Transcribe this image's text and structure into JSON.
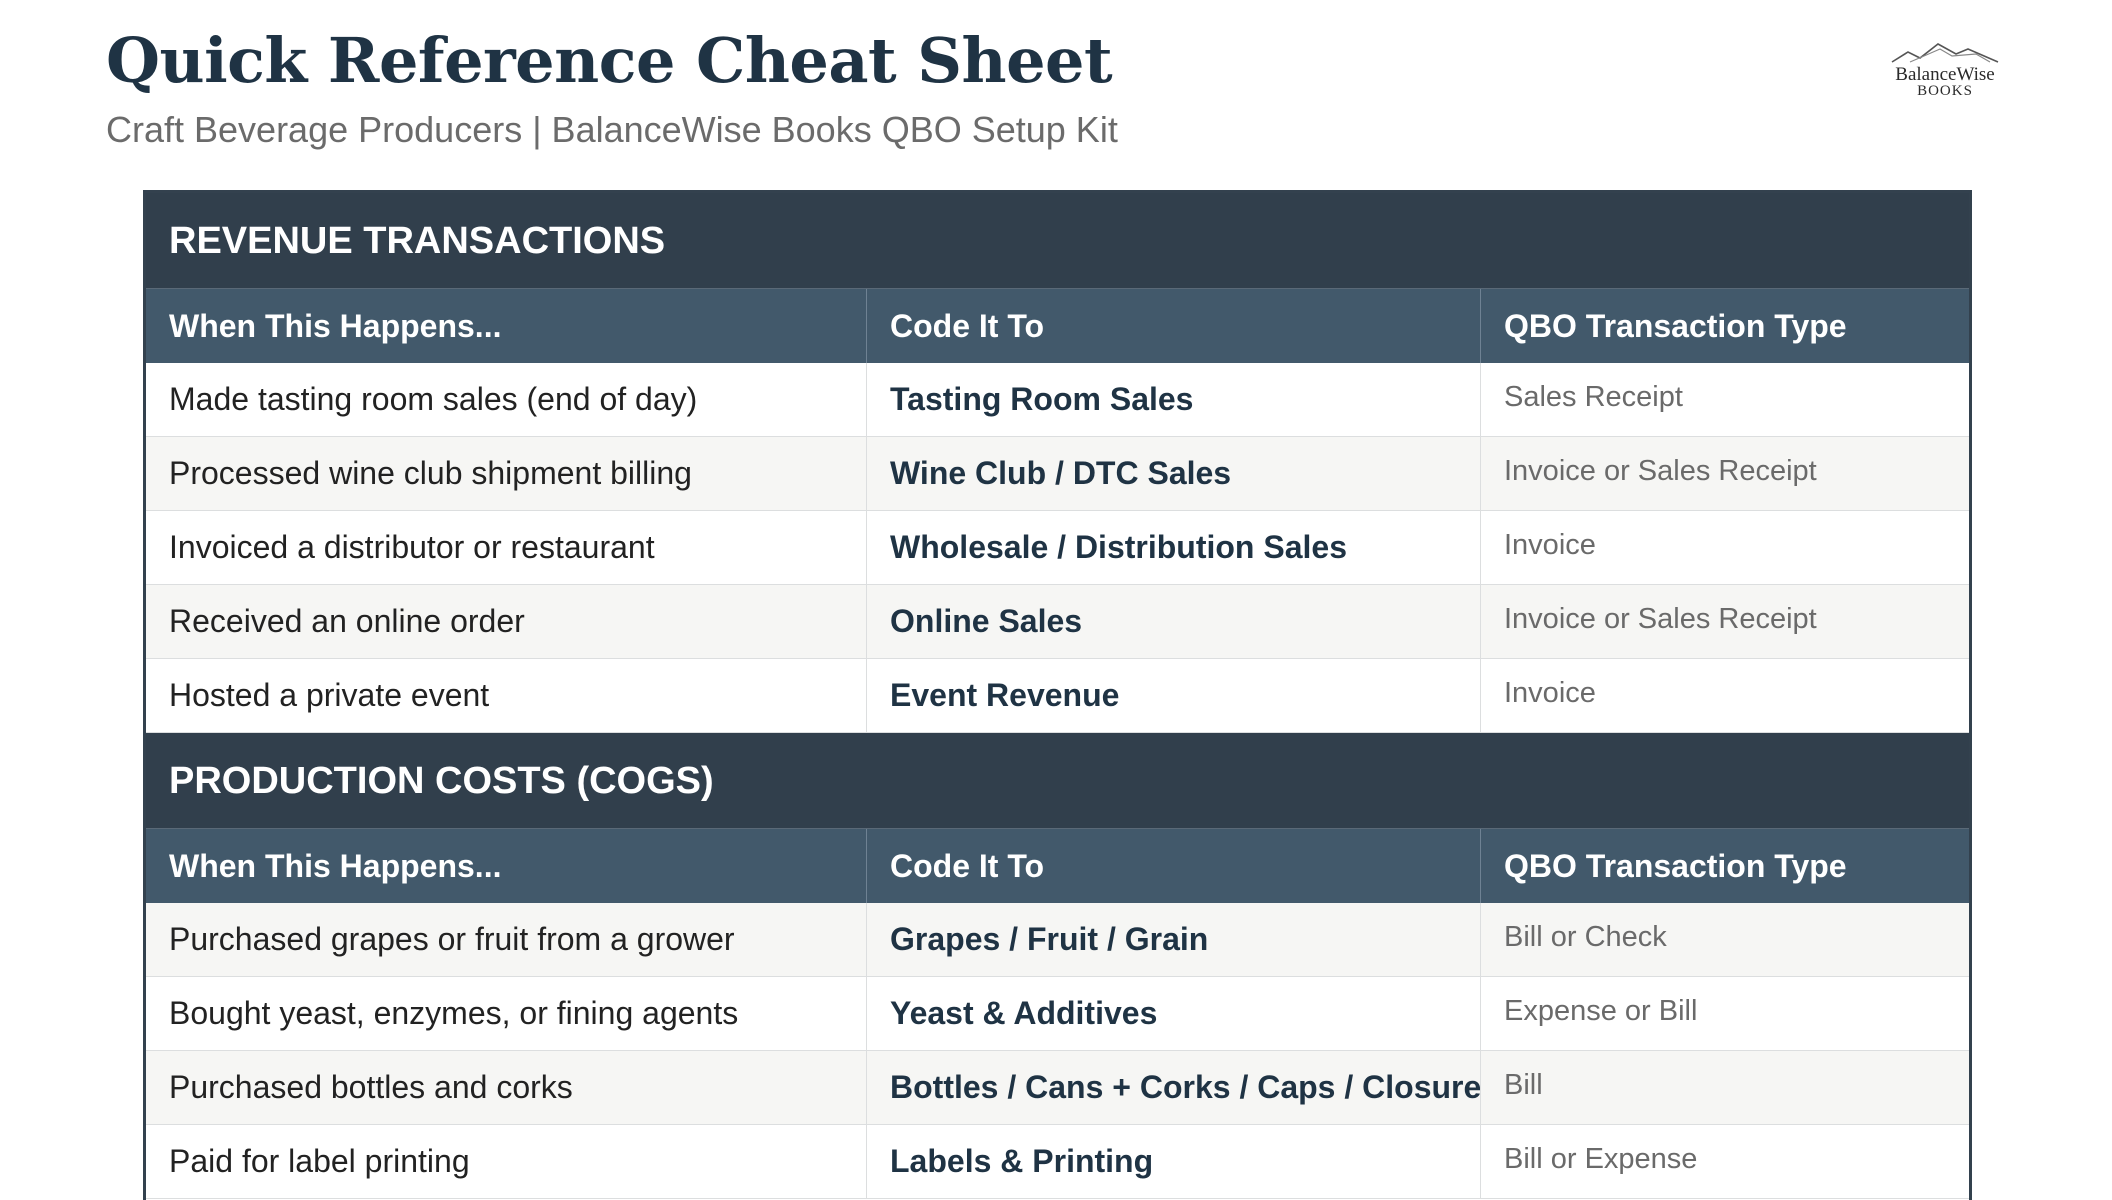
{
  "header": {
    "title": "Quick Reference Cheat Sheet",
    "subtitle": "Craft Beverage Producers | BalanceWise Books QBO Setup Kit"
  },
  "logo": {
    "line1": "BalanceWise",
    "line2": "BOOKS",
    "icon": "mountain-logo-icon",
    "color": "#555555"
  },
  "colors": {
    "section_header": "#313f4c",
    "column_header": "#42596b",
    "title": "#1f3344",
    "alt_row": "#f6f6f4"
  },
  "columns": [
    "When This Happens...",
    "Code It To",
    "QBO Transaction Type"
  ],
  "sections": [
    {
      "title": "REVENUE TRANSACTIONS",
      "rows": [
        [
          "Made tasting room sales (end of day)",
          "Tasting Room Sales",
          "Sales Receipt"
        ],
        [
          "Processed wine club shipment billing",
          "Wine Club / DTC Sales",
          "Invoice or Sales Receipt"
        ],
        [
          "Invoiced a distributor or restaurant",
          "Wholesale / Distribution Sales",
          "Invoice"
        ],
        [
          "Received an online order",
          "Online Sales",
          "Invoice or Sales Receipt"
        ],
        [
          "Hosted a private event",
          "Event Revenue",
          "Invoice"
        ]
      ]
    },
    {
      "title": "PRODUCTION COSTS (COGS)",
      "rows": [
        [
          "Purchased grapes or fruit from a grower",
          "Grapes / Fruit / Grain",
          "Bill or Check"
        ],
        [
          "Bought yeast, enzymes, or fining agents",
          "Yeast & Additives",
          "Expense or Bill"
        ],
        [
          "Purchased bottles and corks",
          "Bottles / Cans + Corks / Caps / Closures",
          "Bill"
        ],
        [
          "Paid for label printing",
          "Labels & Printing",
          "Bill or Expense"
        ]
      ]
    }
  ]
}
